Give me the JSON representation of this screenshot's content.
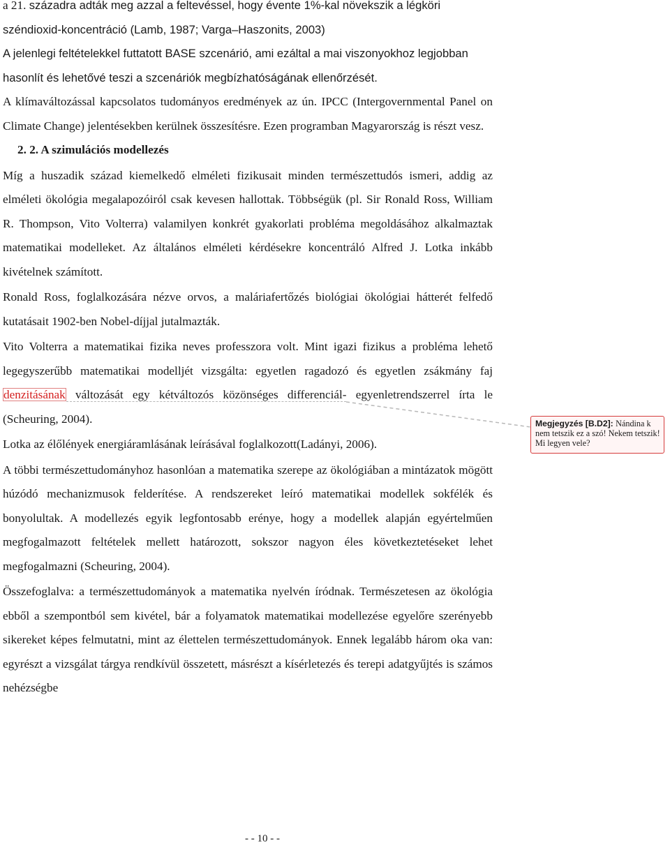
{
  "document": {
    "paragraphs_intro": [
      {
        "pre": "a 21. ",
        "sans": "századra adták meg azzal a feltevéssel, hogy évente 1%-kal növekszik a légköri széndioxid-koncentráció (Lamb, 1987; Varga–Haszonits, 2003)"
      },
      {
        "sans": "A jelenlegi feltételekkel futtatott BASE szcenárió, ami ezáltal a mai viszonyokhoz legjobban hasonlít és lehetővé teszi a szcenáriók megbízhatóságának ellenőrzését."
      }
    ],
    "para_ipcc": "A klímaváltozással kapcsolatos tudományos eredmények az ún. IPCC (Intergovernmental Panel on Climate Change) jelentésekben kerülnek összesítésre. Ezen programban Magyarország is részt vesz.",
    "heading": "2. 2. A szimulációs modellezés",
    "para_1": "Míg a huszadik század kiemelkedő elméleti fizikusait minden természettudós ismeri, addig az elméleti ökológia megalapozóiról csak kevesen hallottak. Többségük (pl. Sir Ronald Ross, William R. Thompson, Vito Volterra) valamilyen konkrét gyakorlati probléma megoldásához alkalmaztak matematikai modelleket. Az általános elméleti kérdésekre koncentráló Alfred J. Lotka inkább kivételnek számított.",
    "para_2": "Ronald Ross, foglalkozására nézve orvos, a maláriafertőzés biológiai ökológiai hátterét felfedő kutatásait 1902-ben Nobel-díjjal jutalmazták.",
    "para_3": {
      "line1": "Vito Volterra a matematikai fizika neves professzora volt. Mint igazi fizikus a probléma lehető legegyszerűbb matematikai modelljét vizsgálta: egyetlen ragadozó és egyetlen zsákmány faj ",
      "highlight": "denzitásának",
      "after": " változását egy kétváltozós közönséges differenciál-",
      "end": "egyenletrendszerrel írta le (Scheuring, 2004)."
    },
    "para_4": "Lotka az élőlények energiáramlásának leírásával foglalkozott(Ladányi, 2006).",
    "para_5": "A többi természettudományhoz hasonlóan a matematika szerepe az ökológiában a mintázatok mögött húzódó mechanizmusok felderítése. A rendszereket leíró matematikai modellek sokfélék és bonyolultak. A modellezés egyik legfontosabb erénye, hogy a modellek alapján egyértelműen megfogalmazott feltételek mellett határozott, sokszor nagyon éles következtetéseket lehet megfogalmazni (Scheuring, 2004).",
    "para_6": "Összefoglalva: a természettudományok a matematika nyelvén íródnak. Természetesen az ökológia ebből a szempontból sem kivétel, bár a folyamatok matematikai modellezése egyelőre szerényebb sikereket képes felmutatni, mint az élettelen természettudományok. Ennek legalább három oka van: egyrészt a vizsgálat tárgya rendkívül összetett, másrészt a kísérletezés és terepi adatgyűjtés is számos nehézségbe",
    "page_number": "- - 10 - -"
  },
  "comment": {
    "label": "Megjegyzés [B.D2]: ",
    "text": "Nándina k nem tetszik ez a szó! Nekem tetszik! Mi legyen vele?",
    "border_color": "#d53b3b",
    "highlight_color": "#d42020"
  }
}
